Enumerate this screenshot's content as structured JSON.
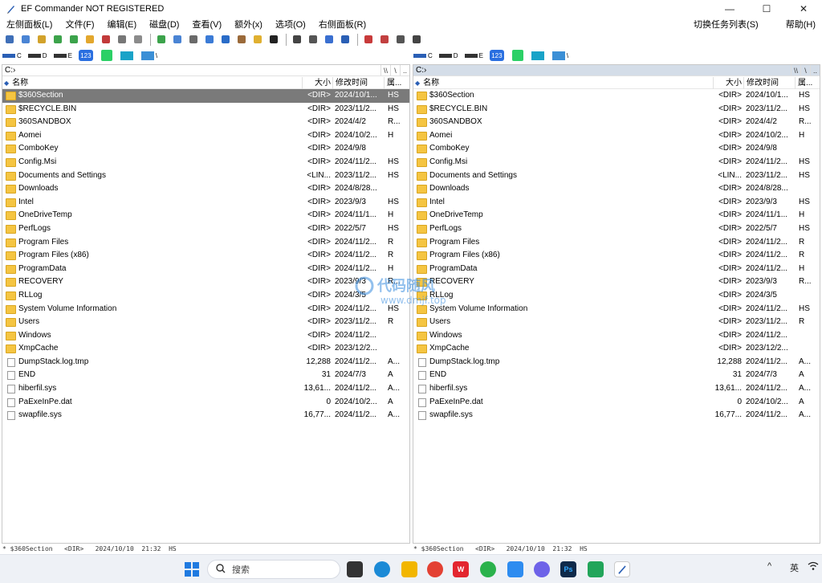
{
  "window": {
    "title": "EF Commander NOT REGISTERED",
    "controls": {
      "minimize": "—",
      "maximize": "☐",
      "close": "✕"
    }
  },
  "menu": {
    "items": [
      "左侧面板(L)",
      "文件(F)",
      "编辑(E)",
      "磁盘(D)",
      "查看(V)",
      "额外(x)",
      "选项(O)",
      "右侧面板(R)"
    ],
    "right": [
      "切换任务列表(S)",
      "帮助(H)"
    ]
  },
  "toolbar": {
    "icons": [
      "copy-panel-icon",
      "search-icon",
      "edit-icon",
      "copy-icon",
      "move-icon",
      "new-folder-icon",
      "delete-icon",
      "print-icon",
      "mail-icon",
      "refresh-icon",
      "find-file-icon",
      "compare-icon",
      "sync-icon",
      "network-icon",
      "unpack-icon",
      "pack-icon",
      "console-icon",
      "view-icon",
      "properties-icon",
      "split-icon",
      "screen-icon",
      "settings-icon",
      "plugins-icon",
      "burn-icon",
      "help-icon"
    ]
  },
  "drives": [
    {
      "icon": "hard-drive-icon",
      "label": "C"
    },
    {
      "icon": "drive-icon",
      "label": "D"
    },
    {
      "icon": "drive-icon",
      "label": "E"
    },
    {
      "icon": "count-icon",
      "label": "123"
    },
    {
      "icon": "desktop-icon",
      "label": ""
    },
    {
      "icon": "monitor-icon",
      "label": ""
    },
    {
      "icon": "network-drive-icon",
      "label": "\\"
    }
  ],
  "left_panel": {
    "path": "C:›",
    "path_buttons": [
      "\\\\",
      "\\",
      ".."
    ],
    "headers": {
      "name": "名称",
      "size": "大小",
      "date": "修改时间",
      "attr": "属..."
    },
    "selected_index": 0
  },
  "right_panel": {
    "path": "C:›",
    "path_buttons": [
      "\\\\",
      "\\",
      ".."
    ],
    "headers": {
      "name": "名称",
      "size": "大小",
      "date": "修改时间",
      "attr": "属..."
    }
  },
  "files": [
    {
      "name": "$360Section",
      "size": "<DIR>",
      "date": "2024/10/1...",
      "attr": "HS",
      "type": "folder"
    },
    {
      "name": "$RECYCLE.BIN",
      "size": "<DIR>",
      "date": "2023/11/2...",
      "attr": "HS",
      "type": "folder"
    },
    {
      "name": "360SANDBOX",
      "size": "<DIR>",
      "date": "2024/4/2",
      "attr": "R...",
      "type": "folder"
    },
    {
      "name": "Aomei",
      "size": "<DIR>",
      "date": "2024/10/2...",
      "attr": "H",
      "type": "folder"
    },
    {
      "name": "ComboKey",
      "size": "<DIR>",
      "date": "2024/9/8",
      "attr": "",
      "type": "folder"
    },
    {
      "name": "Config.Msi",
      "size": "<DIR>",
      "date": "2024/11/2...",
      "attr": "HS",
      "type": "folder"
    },
    {
      "name": "Documents and Settings",
      "size": "<LIN...",
      "date": "2023/11/2...",
      "attr": "HS",
      "type": "link"
    },
    {
      "name": "Downloads",
      "size": "<DIR>",
      "date": "2024/8/28...",
      "attr": "",
      "type": "folder"
    },
    {
      "name": "Intel",
      "size": "<DIR>",
      "date": "2023/9/3",
      "attr": "HS",
      "type": "folder"
    },
    {
      "name": "OneDriveTemp",
      "size": "<DIR>",
      "date": "2024/11/1...",
      "attr": "H",
      "type": "folder"
    },
    {
      "name": "PerfLogs",
      "size": "<DIR>",
      "date": "2022/5/7",
      "attr": "HS",
      "type": "folder"
    },
    {
      "name": "Program Files",
      "size": "<DIR>",
      "date": "2024/11/2...",
      "attr": "R",
      "type": "folder"
    },
    {
      "name": "Program Files (x86)",
      "size": "<DIR>",
      "date": "2024/11/2...",
      "attr": "R",
      "type": "folder"
    },
    {
      "name": "ProgramData",
      "size": "<DIR>",
      "date": "2024/11/2...",
      "attr": "H",
      "type": "folder"
    },
    {
      "name": "RECOVERY",
      "size": "<DIR>",
      "date": "2023/9/3",
      "attr": "R...",
      "type": "folder"
    },
    {
      "name": "RLLog",
      "size": "<DIR>",
      "date": "2024/3/5",
      "attr": "",
      "type": "folder"
    },
    {
      "name": "System Volume Information",
      "size": "<DIR>",
      "date": "2024/11/2...",
      "attr": "HS",
      "type": "folder"
    },
    {
      "name": "Users",
      "size": "<DIR>",
      "date": "2023/11/2...",
      "attr": "R",
      "type": "folder"
    },
    {
      "name": "Windows",
      "size": "<DIR>",
      "date": "2024/11/2...",
      "attr": "",
      "type": "folder"
    },
    {
      "name": "XmpCache",
      "size": "<DIR>",
      "date": "2023/12/2...",
      "attr": "",
      "type": "folder"
    },
    {
      "name": "DumpStack.log.tmp",
      "size": "12,288",
      "date": "2024/11/2...",
      "attr": "A...",
      "type": "file"
    },
    {
      "name": "END",
      "size": "31",
      "date": "2024/7/3",
      "attr": "A",
      "type": "file"
    },
    {
      "name": "hiberfil.sys",
      "size": "13,61...",
      "date": "2024/11/2...",
      "attr": "A...",
      "type": "sysfile"
    },
    {
      "name": "PaExeInPe.dat",
      "size": "0",
      "date": "2024/10/2...",
      "attr": "A",
      "type": "datfile"
    },
    {
      "name": "swapfile.sys",
      "size": "16,77...",
      "date": "2024/11/2...",
      "attr": "A...",
      "type": "sysfile"
    }
  ],
  "status": {
    "left": "* $360Section   <DIR>   2024/10/10  21:32  HS",
    "right": "* $360Section   <DIR>   2024/10/10  21:32  HS"
  },
  "watermark": {
    "line1": "代码随风",
    "line2": "www.dmjf.top"
  },
  "taskbar": {
    "search_placeholder": "搜索",
    "apps": [
      "start-icon",
      "task-view-icon",
      "edge-icon",
      "file-explorer-icon",
      "chrome-icon",
      "wps-icon",
      "wechat-icon",
      "baidu-netdisk-icon",
      "app-icon",
      "photoshop-icon",
      "screenshot-icon",
      "ef-commander-icon"
    ],
    "ps_label": "Ps",
    "tray": {
      "chevron": "^",
      "lang": "英",
      "wifi": "wifi-icon"
    }
  },
  "colors": {
    "selection": "#7a7a7a",
    "folder": "#f5c542",
    "active_path": "#d4dde8",
    "taskbar": "#eef1f6"
  }
}
